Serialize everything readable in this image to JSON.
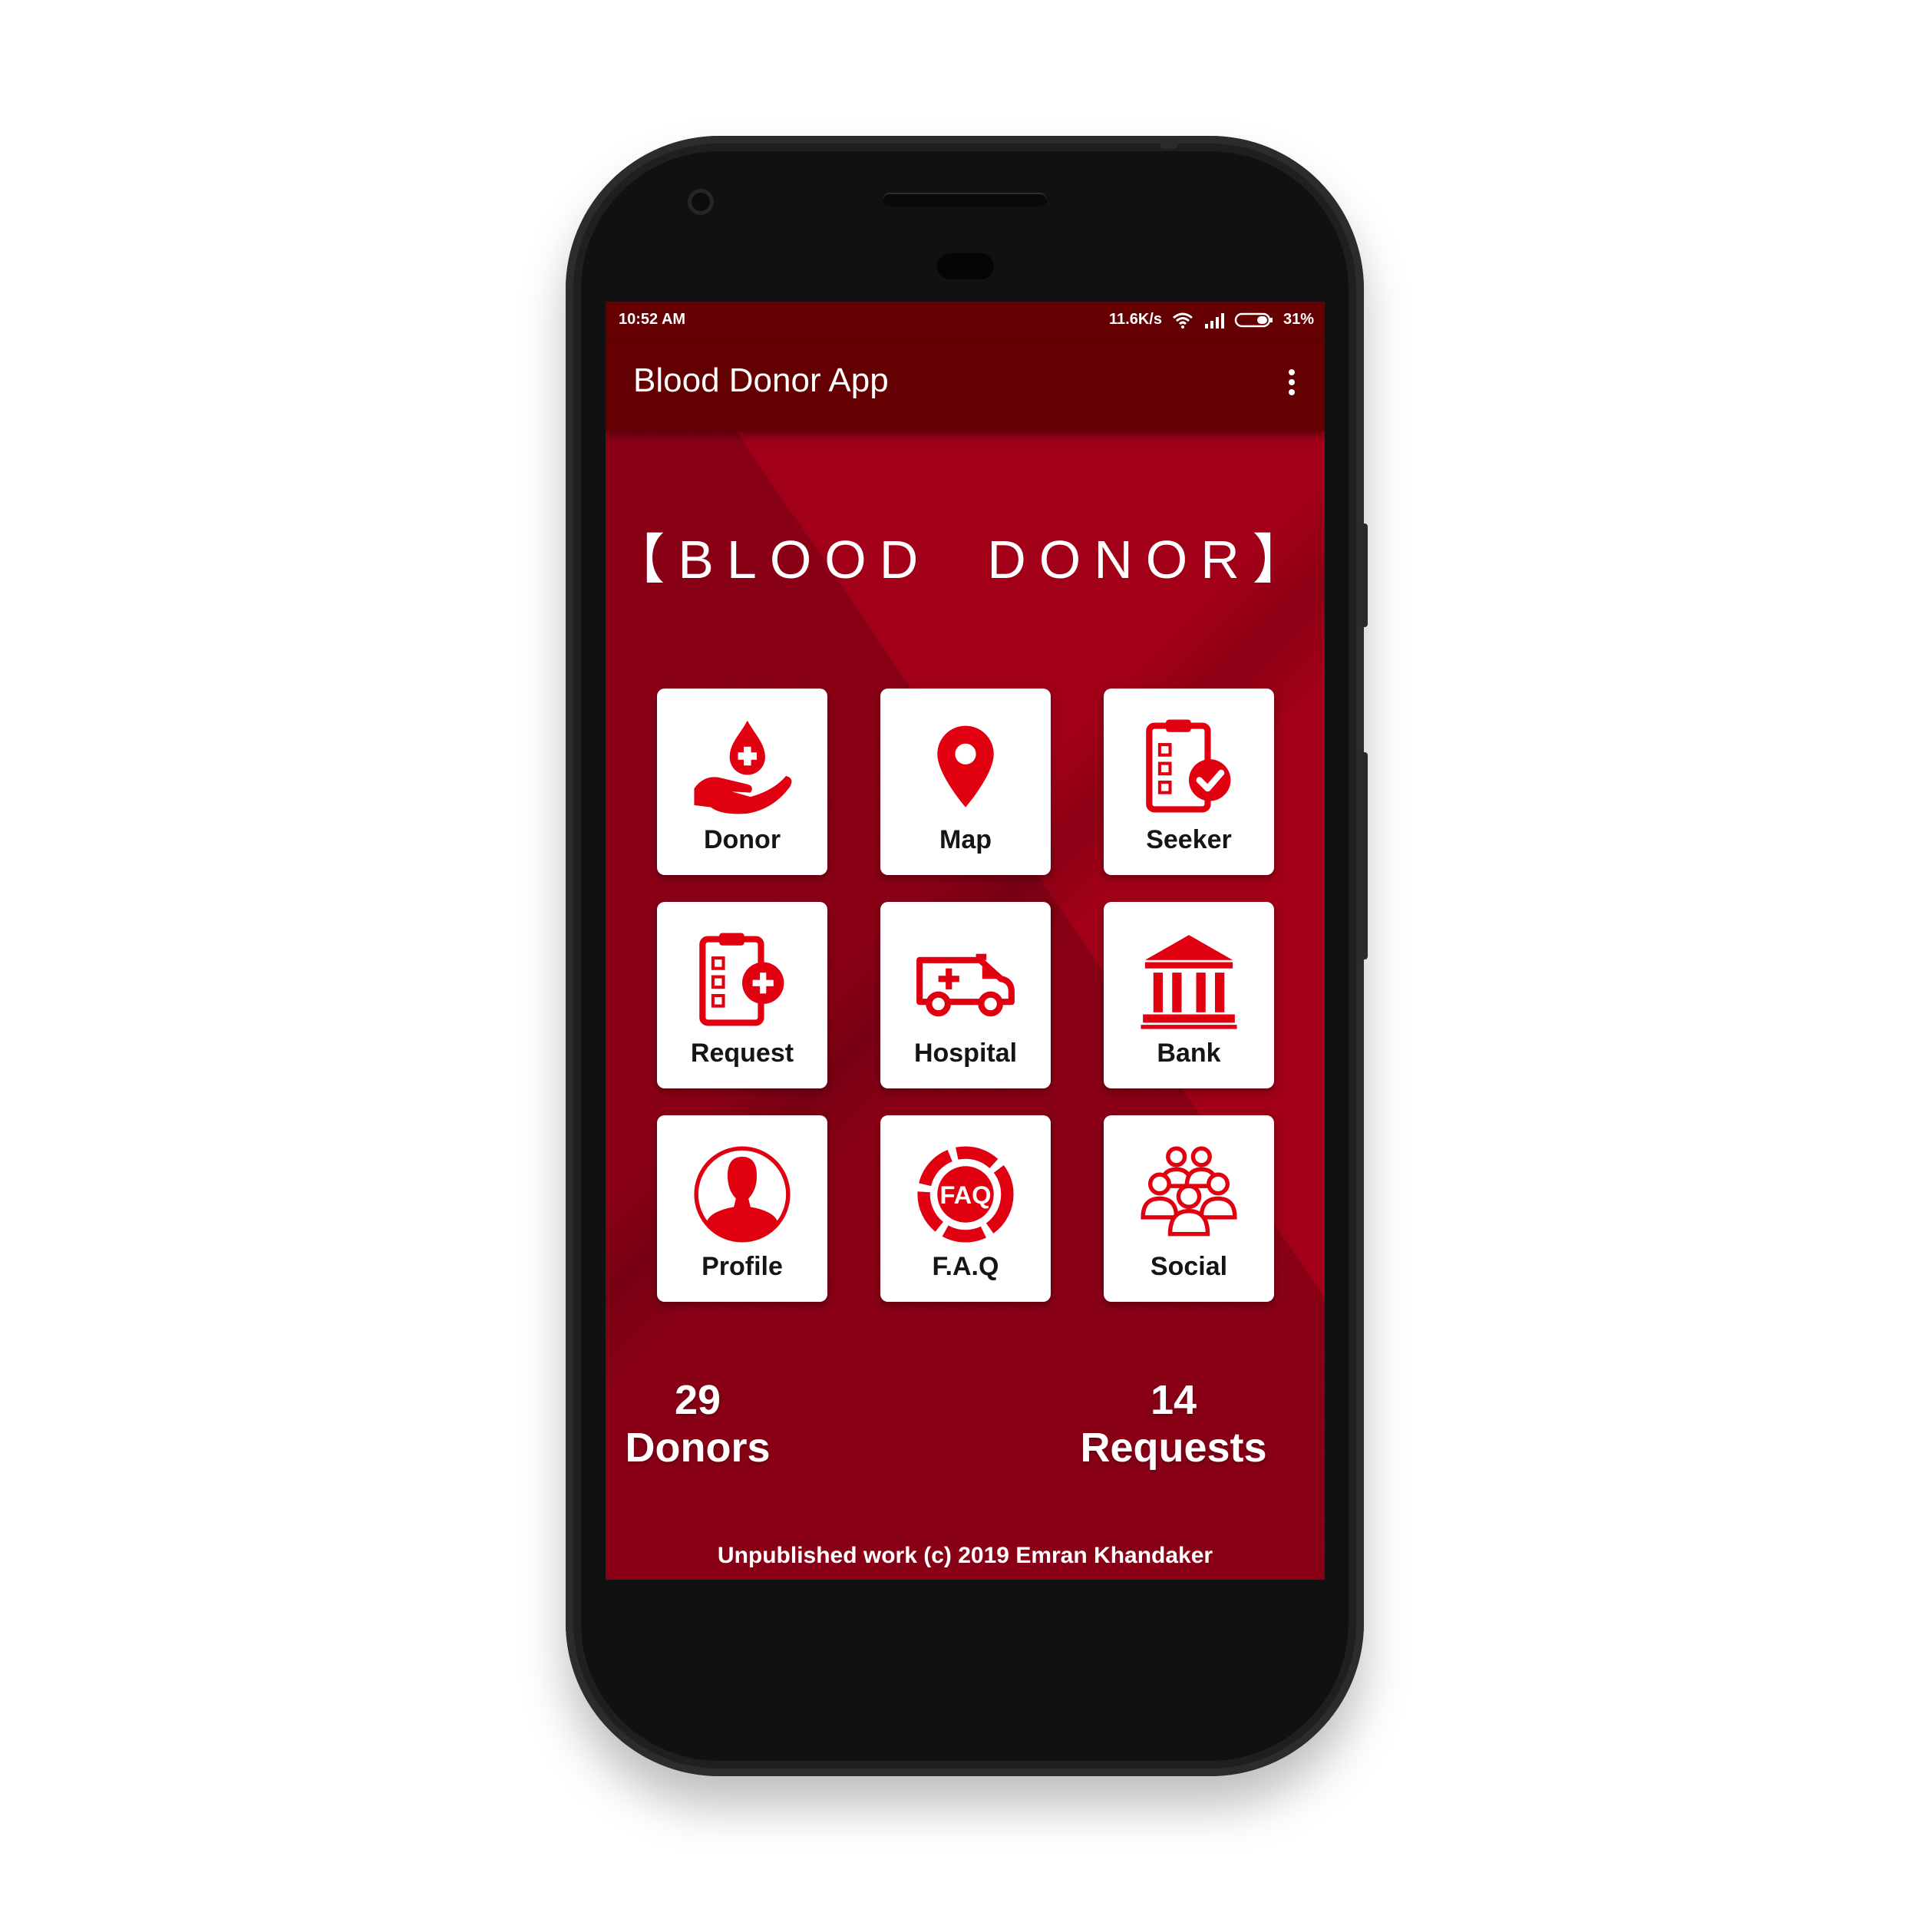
{
  "status_bar": {
    "time": "10:52 AM",
    "speed": "11.6K/s",
    "battery": "31%"
  },
  "app_bar": {
    "title": "Blood Donor App"
  },
  "headline": "【BLOOD  DONOR】",
  "tiles": [
    {
      "label": "Donor",
      "icon": "donate-blood-icon"
    },
    {
      "label": "Map",
      "icon": "map-pin-icon"
    },
    {
      "label": "Seeker",
      "icon": "clipboard-check-icon"
    },
    {
      "label": "Request",
      "icon": "clipboard-plus-icon"
    },
    {
      "label": "Hospital",
      "icon": "ambulance-icon"
    },
    {
      "label": "Bank",
      "icon": "bank-icon"
    },
    {
      "label": "Profile",
      "icon": "user-profile-icon"
    },
    {
      "label": "F.A.Q",
      "icon": "faq-icon",
      "icon_text": "FAQ"
    },
    {
      "label": "Social",
      "icon": "group-icon"
    }
  ],
  "stats": {
    "donors": {
      "count": "29",
      "label": "Donors"
    },
    "requests": {
      "count": "14",
      "label": "Requests"
    }
  },
  "footer": "Unpublished work (c) 2019 Emran Khandaker",
  "colors": {
    "primary_dark": "#640002",
    "primary": "#a10018",
    "icon_red": "#e0000f"
  }
}
